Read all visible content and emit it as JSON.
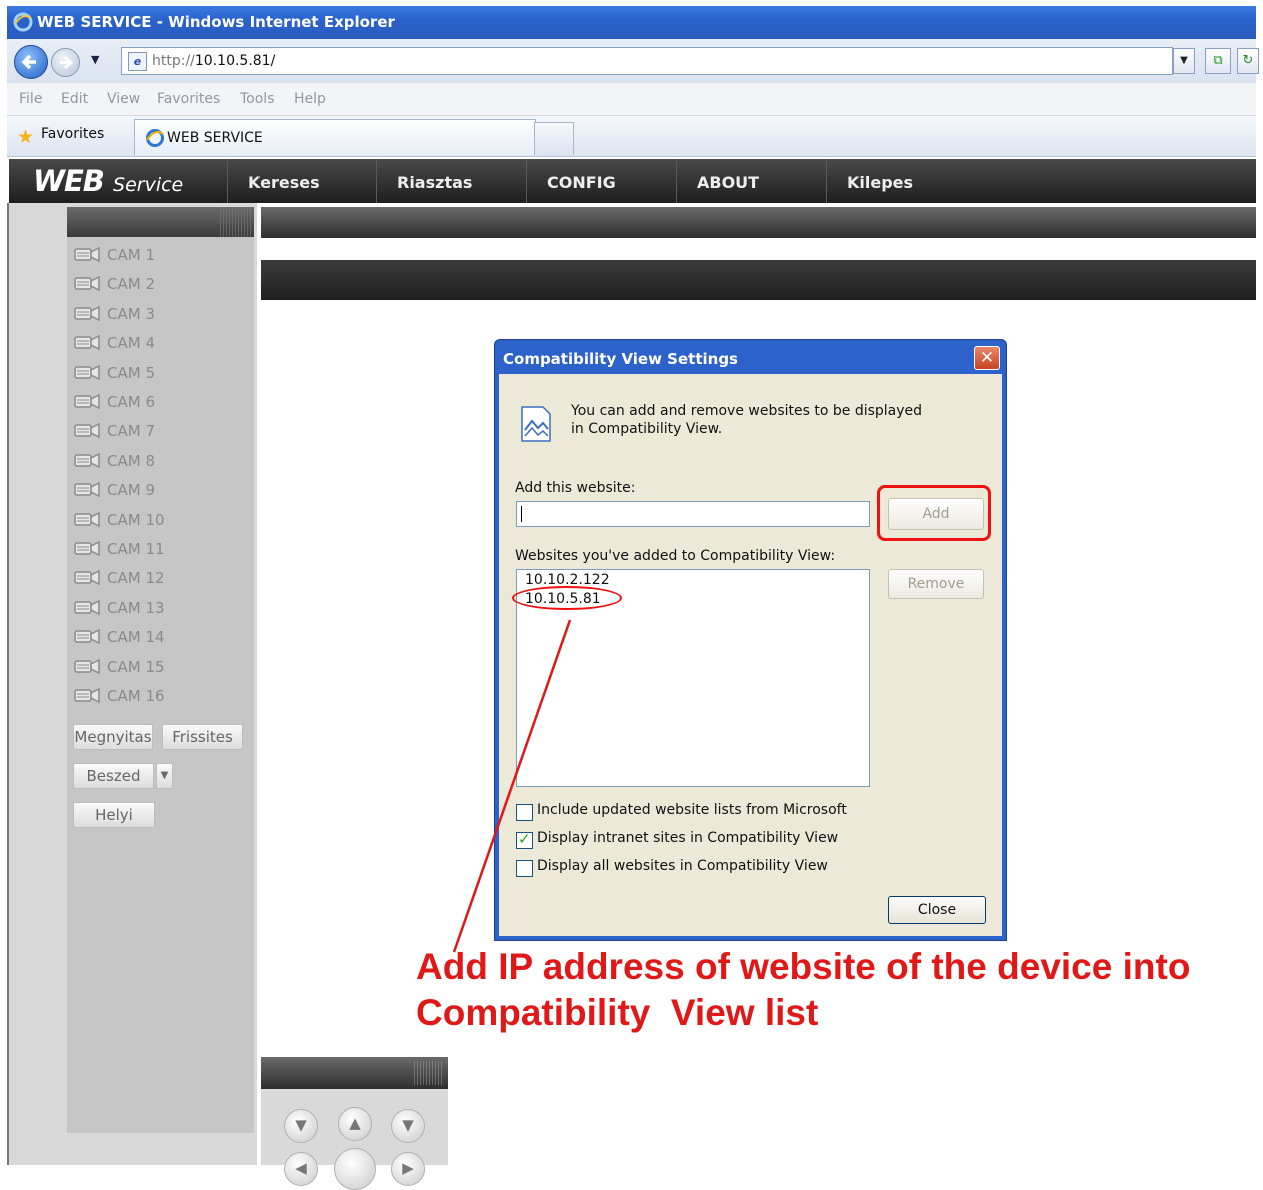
{
  "browser": {
    "window_title": "WEB SERVICE - Windows Internet Explorer",
    "address_prefix": "http://",
    "address_host": "10.10.5.81/",
    "menu": [
      "File",
      "Edit",
      "View",
      "Favorites",
      "Tools",
      "Help"
    ],
    "favorites_label": "Favorites",
    "tab_title": "WEB SERVICE"
  },
  "app": {
    "logo_main": "WEB",
    "logo_sub": "Service",
    "nav": [
      "Kereses",
      "Riasztas",
      "CONFIG",
      "ABOUT",
      "Kilepes"
    ],
    "cameras": [
      "CAM 1",
      "CAM 2",
      "CAM 3",
      "CAM 4",
      "CAM 5",
      "CAM 6",
      "CAM 7",
      "CAM 8",
      "CAM 9",
      "CAM 10",
      "CAM 11",
      "CAM 12",
      "CAM 13",
      "CAM 14",
      "CAM 15",
      "CAM 16"
    ],
    "buttons": {
      "open": "Megnyitas",
      "refresh": "Frissites",
      "talk": "Beszed",
      "talk_dropdown": "▼",
      "local": "Helyi"
    }
  },
  "dialog": {
    "title": "Compatibility View Settings",
    "close_x": "✕",
    "intro": "You can add and remove websites to be displayed in Compatibility View.",
    "add_label": "Add this website:",
    "add_input_value": "",
    "add_button": "Add",
    "list_label": "Websites you've added to Compatibility View:",
    "websites": [
      "10.10.2.122",
      "10.10.5.81"
    ],
    "remove_button": "Remove",
    "options": [
      {
        "label": "Include updated website lists from Microsoft",
        "checked": false
      },
      {
        "label": "Display intranet sites in Compatibility View",
        "checked": true
      },
      {
        "label": "Display all websites in Compatibility View",
        "checked": false
      }
    ],
    "close_button": "Close"
  },
  "annotation": {
    "text_line1": "Add IP address of website of the device into",
    "text_line2": "Compatibility  View list",
    "color": "#e01818"
  }
}
